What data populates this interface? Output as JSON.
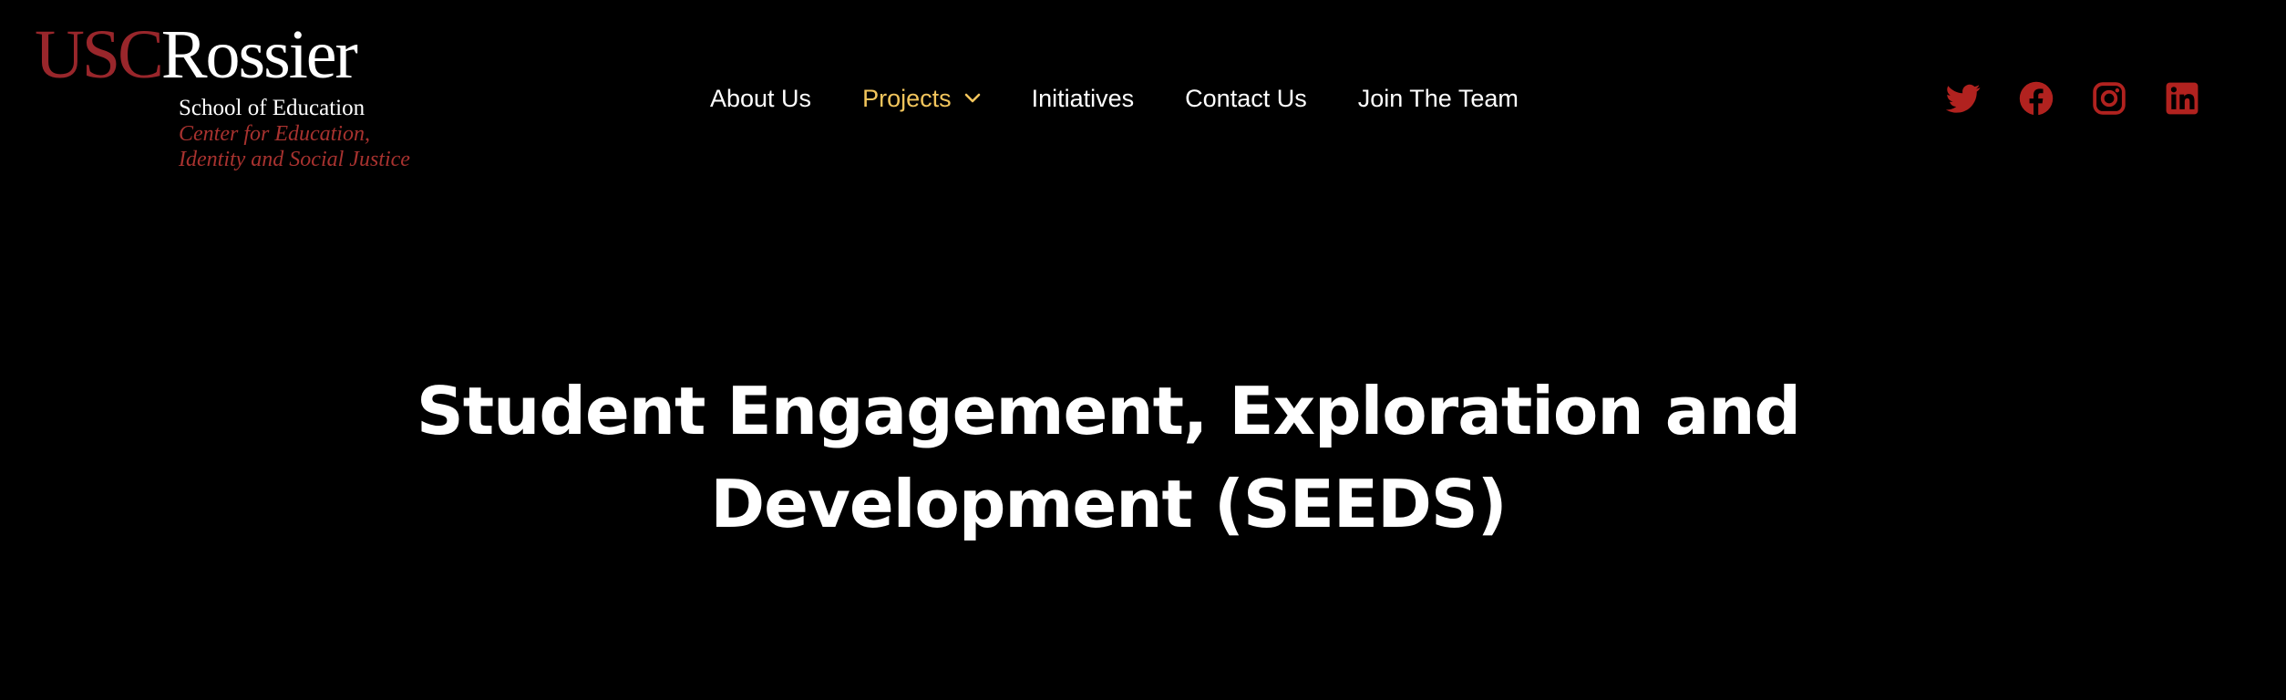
{
  "logo": {
    "usc": "USC",
    "rossier": "Rossier",
    "school": "School of Education",
    "center_line1": "Center for Education,",
    "center_line2": "Identity and Social Justice"
  },
  "nav": {
    "items": [
      {
        "label": "About Us"
      },
      {
        "label": "Projects",
        "has_dropdown": true,
        "active": true
      },
      {
        "label": "Initiatives"
      },
      {
        "label": "Contact Us"
      },
      {
        "label": "Join The Team"
      }
    ]
  },
  "social": {
    "icons": [
      "twitter-icon",
      "facebook-icon",
      "instagram-icon",
      "linkedin-icon"
    ]
  },
  "hero": {
    "title_line1": "Student Engagement, Exploration and",
    "title_line2": "Development (SEEDS)"
  },
  "colors": {
    "background": "#000000",
    "brand_red": "#99262b",
    "social_red": "#b1221f",
    "active_nav": "#f2c55c",
    "text": "#ffffff"
  }
}
